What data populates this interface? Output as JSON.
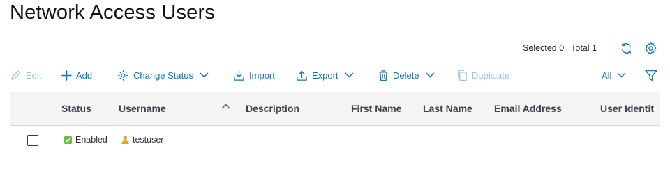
{
  "page": {
    "title": "Network Access Users"
  },
  "summary": {
    "selected_label": "Selected 0",
    "total_label": "Total 1",
    "refresh_icon": "refresh-icon",
    "settings_icon": "gear-icon"
  },
  "toolbar": {
    "edit": "Edit",
    "add": "Add",
    "change_status": "Change Status",
    "import": "Import",
    "export": "Export",
    "delete": "Delete",
    "duplicate": "Duplicate",
    "filter_value": "All"
  },
  "table": {
    "columns": [
      "Status",
      "Username",
      "Description",
      "First Name",
      "Last Name",
      "Email Address",
      "User Identit"
    ],
    "rows": [
      {
        "status": "Enabled",
        "username": "testuser",
        "description": "",
        "first_name": "",
        "last_name": "",
        "email": "",
        "identity": ""
      }
    ]
  },
  "colors": {
    "accent": "#0b77b6",
    "accent_disabled": "#9bc7e2",
    "status_enabled": "#6abf40",
    "user_icon": "#e2a62a",
    "header_bg": "#f4f4f4"
  }
}
